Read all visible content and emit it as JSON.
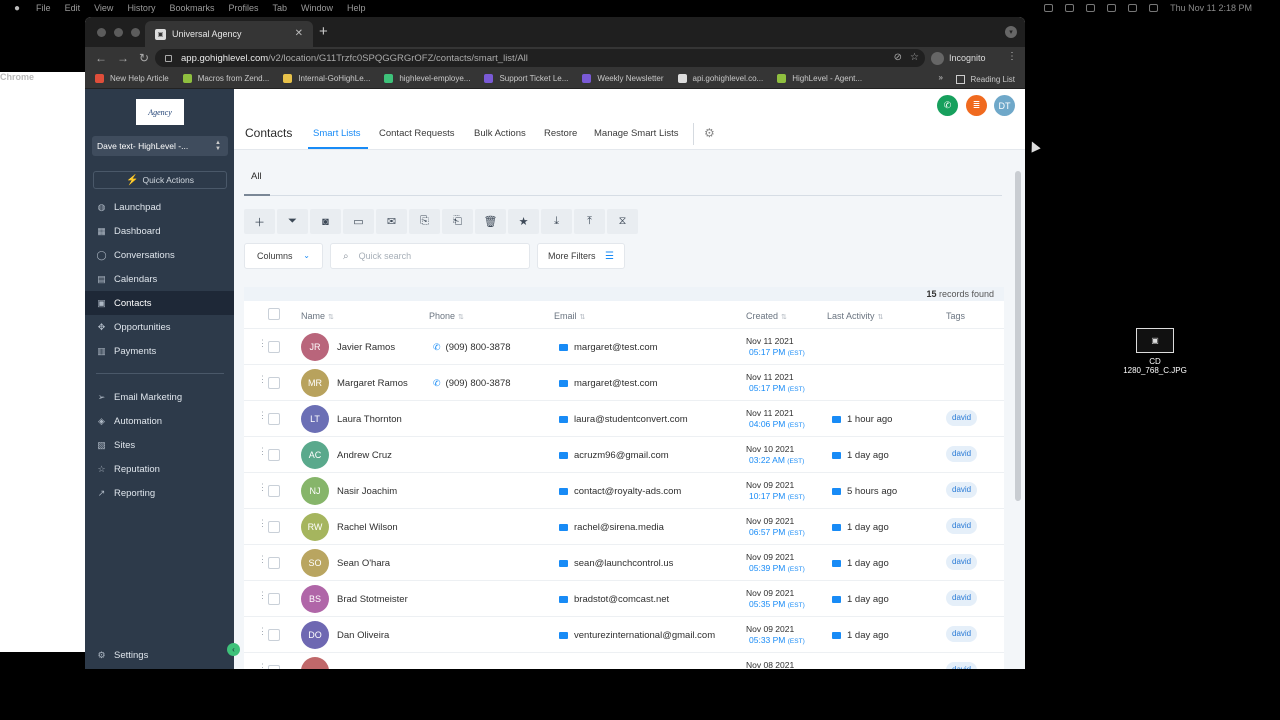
{
  "menubar": {
    "apple": "",
    "app": "Chrome",
    "items": [
      "File",
      "Edit",
      "View",
      "History",
      "Bookmarks",
      "Profiles",
      "Tab",
      "Window",
      "Help"
    ],
    "clock": "Thu Nov 11  2:18 PM"
  },
  "browser": {
    "tab_title": "Universal Agency",
    "url_host": "app.gohighlevel.com",
    "url_path": "/v2/location/G11Trzfc0SPQGGRGrOFZ/contacts/smart_list/All",
    "incognito": "Incognito",
    "bookmarks": [
      {
        "label": "New Help Article",
        "color": "#e04e3a"
      },
      {
        "label": "Macros from Zend...",
        "color": "#8fbf3f"
      },
      {
        "label": "Internal-GoHighLe...",
        "color": "#e8c24a"
      },
      {
        "label": "highlevel-employe...",
        "color": "#3ec27a"
      },
      {
        "label": "Support Ticket Le...",
        "color": "#7a5ad6"
      },
      {
        "label": "Weekly Newsletter",
        "color": "#7a5ad6"
      },
      {
        "label": "api.gohighlevel.co...",
        "color": "#dddddd"
      },
      {
        "label": "HighLevel - Agent...",
        "color": "#8fbf3f"
      }
    ],
    "bookmarks_more": "»",
    "reading_list": "Reading List"
  },
  "sidebar": {
    "logo": "Agency",
    "location": "Dave text- HighLevel -...",
    "quick_actions": "Quick Actions",
    "items": [
      {
        "label": "Launchpad",
        "icon": "rocket-icon",
        "glyph": "◍"
      },
      {
        "label": "Dashboard",
        "icon": "dashboard-icon",
        "glyph": "▦"
      },
      {
        "label": "Conversations",
        "icon": "chat-icon",
        "glyph": "◯"
      },
      {
        "label": "Calendars",
        "icon": "calendar-icon",
        "glyph": "▤"
      },
      {
        "label": "Contacts",
        "icon": "contacts-icon",
        "glyph": "▣"
      },
      {
        "label": "Opportunities",
        "icon": "opportunities-icon",
        "glyph": "✥"
      },
      {
        "label": "Payments",
        "icon": "payments-icon",
        "glyph": "▥"
      },
      {
        "label": "Email Marketing",
        "icon": "send-icon",
        "glyph": "➢"
      },
      {
        "label": "Automation",
        "icon": "automation-icon",
        "glyph": "◈"
      },
      {
        "label": "Sites",
        "icon": "sites-icon",
        "glyph": "▧"
      },
      {
        "label": "Reputation",
        "icon": "star-icon",
        "glyph": "☆"
      },
      {
        "label": "Reporting",
        "icon": "chart-icon",
        "glyph": "↗"
      }
    ],
    "settings": "Settings"
  },
  "header": {
    "avatar_initials": "DT",
    "colors": {
      "phone": "#17a05d",
      "list": "#f06a1f",
      "avatar": "#6fa8c9"
    }
  },
  "topnav": {
    "title": "Contacts",
    "items": [
      "Smart Lists",
      "Contact Requests",
      "Bulk Actions",
      "Restore",
      "Manage Smart Lists"
    ]
  },
  "list": {
    "all_tab": "All",
    "columns_label": "Columns",
    "search_placeholder": "Quick search",
    "more_filters": "More Filters",
    "records_count": "15",
    "records_label": " records found"
  },
  "table": {
    "headers": {
      "name": "Name",
      "phone": "Phone",
      "email": "Email",
      "created": "Created",
      "last_activity": "Last Activity",
      "tags": "Tags"
    },
    "rows": [
      {
        "initials": "JR",
        "color": "#b9657b",
        "name": "Javier Ramos",
        "phone": "(909) 800-3878",
        "email": "margaret@test.com",
        "date": "Nov 11 2021",
        "time": "05:17 PM",
        "tz": "(EST)",
        "activity": "",
        "tag": ""
      },
      {
        "initials": "MR",
        "color": "#b8a25d",
        "name": "Margaret Ramos",
        "phone": "(909) 800-3878",
        "email": "margaret@test.com",
        "date": "Nov 11 2021",
        "time": "05:17 PM",
        "tz": "(EST)",
        "activity": "",
        "tag": ""
      },
      {
        "initials": "LT",
        "color": "#6b6fb5",
        "name": "Laura Thornton",
        "phone": "",
        "email": "laura@studentconvert.com",
        "date": "Nov 11 2021",
        "time": "04:06 PM",
        "tz": "(EST)",
        "activity": "1 hour ago",
        "tag": "david"
      },
      {
        "initials": "AC",
        "color": "#5aa98c",
        "name": "Andrew Cruz",
        "phone": "",
        "email": "acruzm96@gmail.com",
        "date": "Nov 10 2021",
        "time": "03:22 AM",
        "tz": "(EST)",
        "activity": "1 day ago",
        "tag": "david"
      },
      {
        "initials": "NJ",
        "color": "#86b56a",
        "name": "Nasir Joachim",
        "phone": "",
        "email": "contact@royalty-ads.com",
        "date": "Nov 09 2021",
        "time": "10:17 PM",
        "tz": "(EST)",
        "activity": "5 hours ago",
        "tag": "david"
      },
      {
        "initials": "RW",
        "color": "#a5b55e",
        "name": "Rachel Wilson",
        "phone": "",
        "email": "rachel@sirena.media",
        "date": "Nov 09 2021",
        "time": "06:57 PM",
        "tz": "(EST)",
        "activity": "1 day ago",
        "tag": "david"
      },
      {
        "initials": "SO",
        "color": "#b9a560",
        "name": "Sean O'hara",
        "phone": "",
        "email": "sean@launchcontrol.us",
        "date": "Nov 09 2021",
        "time": "05:39 PM",
        "tz": "(EST)",
        "activity": "1 day ago",
        "tag": "david"
      },
      {
        "initials": "BS",
        "color": "#b066a8",
        "name": "Brad Stotmeister",
        "phone": "",
        "email": "bradstot@comcast.net",
        "date": "Nov 09 2021",
        "time": "05:35 PM",
        "tz": "(EST)",
        "activity": "1 day ago",
        "tag": "david"
      },
      {
        "initials": "DO",
        "color": "#6e68b2",
        "name": "Dan Oliveira",
        "phone": "",
        "email": "venturezinternational@gmail.com",
        "date": "Nov 09 2021",
        "time": "05:33 PM",
        "tz": "(EST)",
        "activity": "1 day ago",
        "tag": "david"
      },
      {
        "initials": "",
        "color": "#c0686a",
        "name": "",
        "phone": "",
        "email": "",
        "date": "Nov 08 2021",
        "time": "",
        "tz": "",
        "activity": "",
        "tag": "david"
      }
    ]
  },
  "desktop": {
    "file_line1": "CD",
    "file_line2": "1280_768_C.JPG"
  }
}
